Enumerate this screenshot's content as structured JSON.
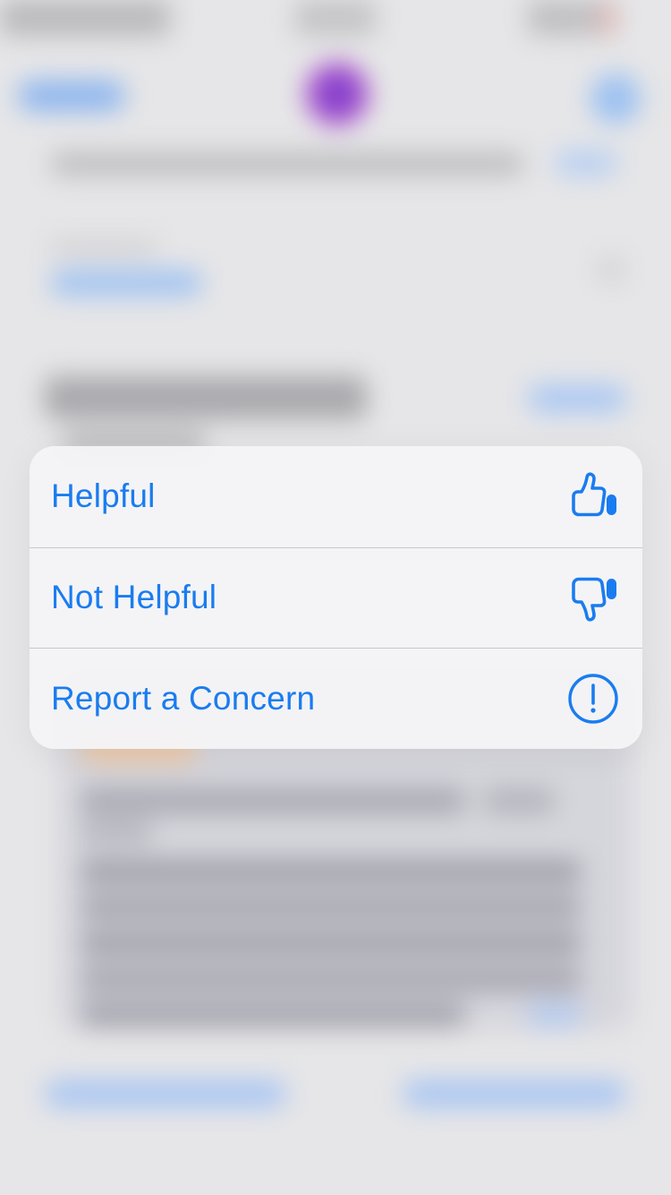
{
  "context_menu": {
    "items": [
      {
        "label": "Helpful",
        "icon": "thumbs-up-icon"
      },
      {
        "label": "Not Helpful",
        "icon": "thumbs-down-icon"
      },
      {
        "label": "Report a Concern",
        "icon": "exclamation-circle-icon"
      }
    ]
  },
  "colors": {
    "accent": "#1a7cf0",
    "menu_background": "#f4f4f6",
    "separator": "#c8c8cc",
    "backdrop": "#e6e6e8"
  }
}
